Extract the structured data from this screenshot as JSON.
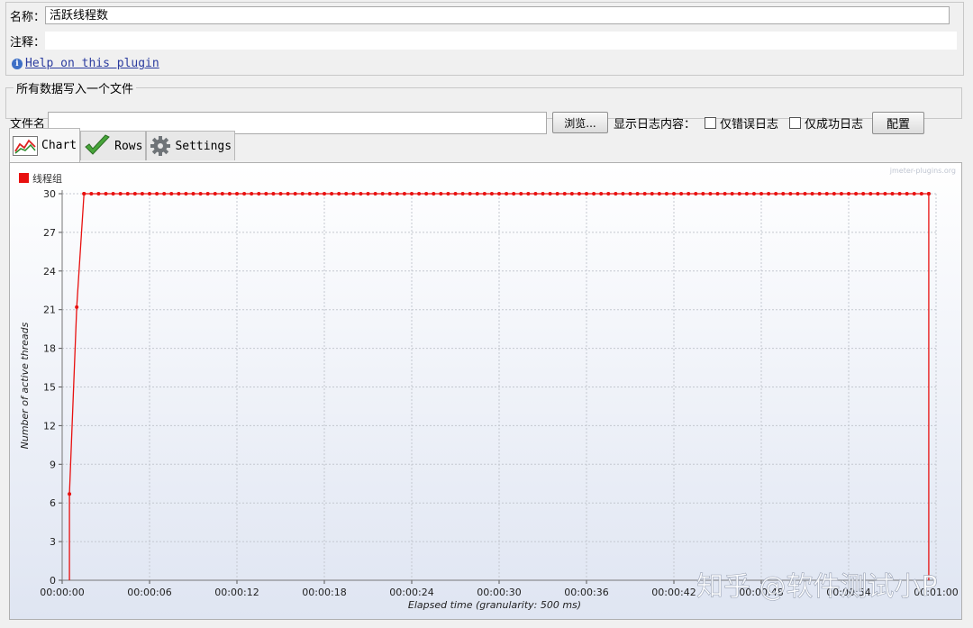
{
  "form": {
    "name_label": "名称：",
    "name_value": "活跃线程数",
    "comment_label": "注释：",
    "comment_value": "",
    "help_link": "Help on this plugin"
  },
  "file_panel": {
    "legend": "所有数据写入一个文件",
    "filename_label": "文件名",
    "filename_value": "",
    "browse_button": "浏览...",
    "log_content_label": "显示日志内容：",
    "errors_only_label": "仅错误日志",
    "success_only_label": "仅成功日志",
    "configure_button": "配置"
  },
  "tabs": [
    {
      "label": "Chart",
      "icon": "chart-icon",
      "active": true
    },
    {
      "label": "Rows",
      "icon": "checkmark-icon",
      "active": false
    },
    {
      "label": "Settings",
      "icon": "gear-icon",
      "active": false
    }
  ],
  "chart_data": {
    "type": "line",
    "watermark": "jmeter-plugins.org",
    "ylabel": "Number of active threads",
    "xlabel": "Elapsed time (granularity: 500 ms)",
    "ylim": [
      0,
      30
    ],
    "yticks": [
      0,
      3,
      6,
      9,
      12,
      15,
      18,
      21,
      24,
      27,
      30
    ],
    "xlim_seconds": [
      0,
      60
    ],
    "xtick_labels": [
      "00:00:00",
      "00:00:06",
      "00:00:12",
      "00:00:18",
      "00:00:24",
      "00:00:30",
      "00:00:36",
      "00:00:42",
      "00:00:48",
      "00:00:54",
      "00:01:00"
    ],
    "grid": true,
    "legend_position": "top-left",
    "series": [
      {
        "name": "线程组",
        "color": "#e8100f",
        "points_seconds": [
          [
            0.5,
            0
          ],
          [
            0.5,
            6.7
          ],
          [
            1.0,
            21.2
          ],
          [
            1.5,
            30
          ],
          [
            59.5,
            30
          ],
          [
            59.5,
            0
          ]
        ],
        "plateau": {
          "from_s": 1.5,
          "to_s": 59.5,
          "step_s": 0.5,
          "value": 30
        }
      }
    ]
  },
  "overlay_watermark": "知乎 @软件测试小P"
}
